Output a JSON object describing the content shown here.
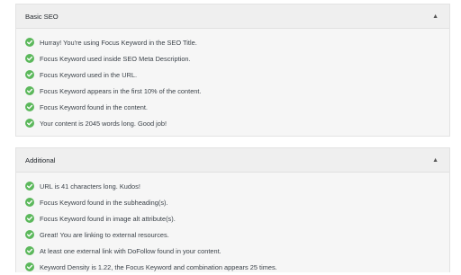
{
  "colors": {
    "check": "#5cb85c",
    "panel_bg": "#f6f6f6",
    "header_bg": "#efefef",
    "text": "#3c434a"
  },
  "sections": [
    {
      "title": "Basic SEO",
      "toggle_icon": "caret-up-icon",
      "items": [
        "Hurray! You're using Focus Keyword in the SEO Title.",
        "Focus Keyword used inside SEO Meta Description.",
        "Focus Keyword used in the URL.",
        "Focus Keyword appears in the first 10% of the content.",
        "Focus Keyword found in the content.",
        "Your content is 2045 words long. Good job!"
      ]
    },
    {
      "title": "Additional",
      "toggle_icon": "caret-up-icon",
      "items": [
        "URL is 41 characters long. Kudos!",
        "Focus Keyword found in the subheading(s).",
        "Focus Keyword found in image alt attribute(s).",
        "Great! You are linking to external resources.",
        "At least one external link with DoFollow found in your content.",
        "Keyword Density is 1.22, the Focus Keyword and combination appears 25 times."
      ]
    }
  ]
}
